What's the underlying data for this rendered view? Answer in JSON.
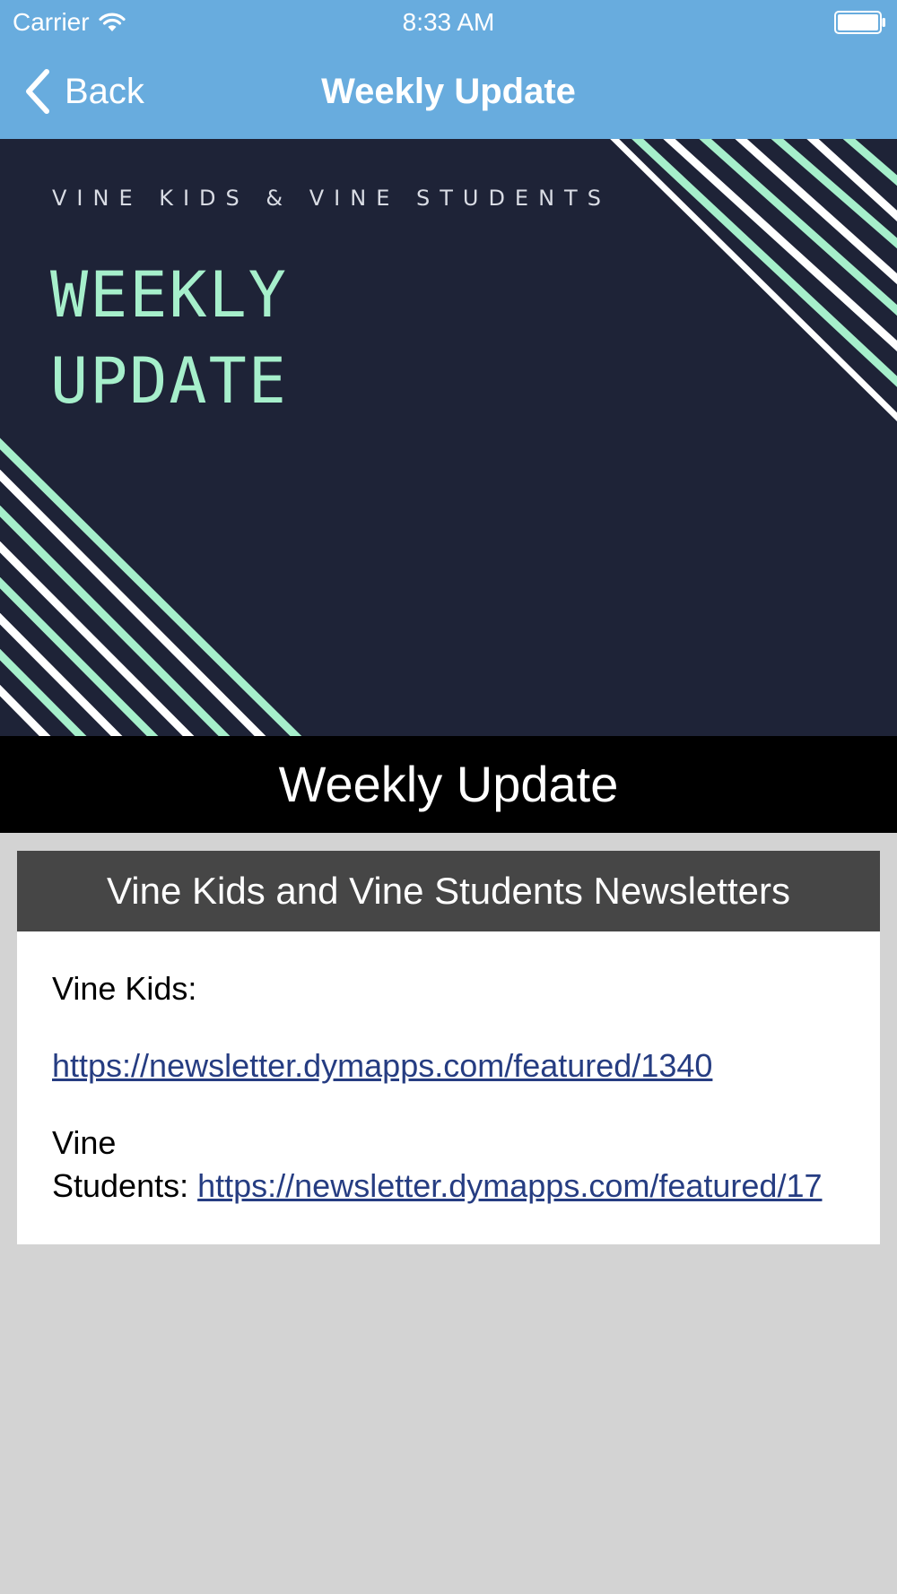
{
  "status_bar": {
    "carrier": "Carrier",
    "time": "8:33 AM"
  },
  "nav": {
    "back_label": "Back",
    "title": "Weekly Update"
  },
  "hero": {
    "subtitle": "VINE KIDS & VINE STUDENTS",
    "title_line1": "WEEKLY",
    "title_line2": "UPDATE",
    "colors": {
      "background": "#1e2337",
      "accent": "#a6efcb",
      "stripe_white": "#ffffff"
    }
  },
  "page_heading": "Weekly Update",
  "card": {
    "header": "Vine Kids and Vine Students Newsletters",
    "kids_label": "Vine Kids:",
    "kids_link": "https://newsletter.dymapps.com/featured/1340",
    "students_label_line1": "Vine",
    "students_label_line2": "Students: ",
    "students_link": "https://newsletter.dymapps.com/featured/17"
  },
  "colors": {
    "nav_bar": "#68acde",
    "page_background": "#d3d3d3",
    "card_header": "#464646",
    "link": "#263d82"
  }
}
